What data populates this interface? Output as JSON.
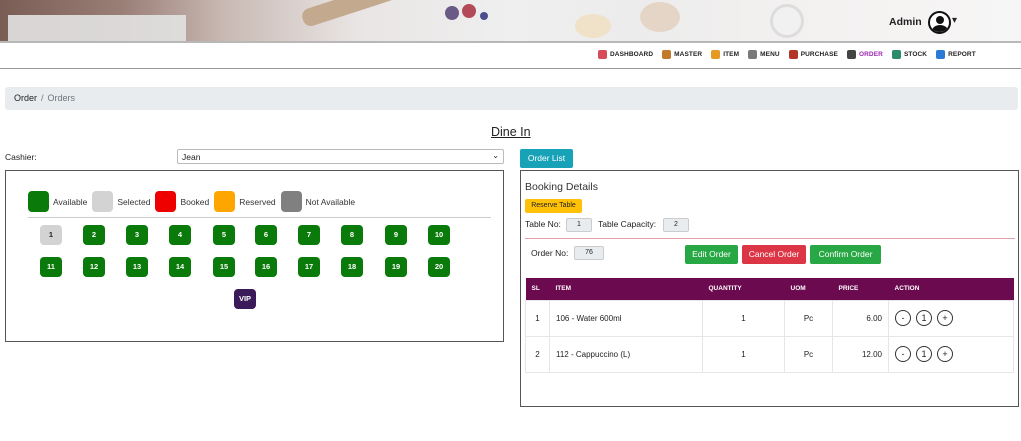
{
  "header": {
    "user_label": "Admin"
  },
  "nav": [
    {
      "label": "DASHBOARD",
      "icon": "dashboard-icon",
      "color": "#d84a5a"
    },
    {
      "label": "MASTER",
      "icon": "master-icon",
      "color": "#c07a2a"
    },
    {
      "label": "ITEM",
      "icon": "item-icon",
      "color": "#e59a22"
    },
    {
      "label": "MENU",
      "icon": "menu-icon",
      "color": "#7a7a7a"
    },
    {
      "label": "PURCHASE",
      "icon": "purchase-icon",
      "color": "#b5342a"
    },
    {
      "label": "ORDER",
      "icon": "order-icon",
      "color": "#444444",
      "active": true
    },
    {
      "label": "STOCK",
      "icon": "stock-icon",
      "color": "#2a8c6a"
    },
    {
      "label": "REPORT",
      "icon": "report-icon",
      "color": "#2a7ad8"
    }
  ],
  "breadcrumb": {
    "root": "Order",
    "separator": "/",
    "current": "Orders"
  },
  "page": {
    "title": "Dine In"
  },
  "cashier": {
    "label": "Cashier:",
    "selected": "Jean"
  },
  "buttons": {
    "order_list": "Order List"
  },
  "legend": [
    {
      "label": "Available",
      "color": "#0a7a0a"
    },
    {
      "label": "Selected",
      "color": "#d3d3d3"
    },
    {
      "label": "Booked",
      "color": "#ee0000"
    },
    {
      "label": "Reserved",
      "color": "#ffa500"
    },
    {
      "label": "Not Available",
      "color": "#808080"
    }
  ],
  "tables": [
    {
      "no": "1",
      "state": "selected"
    },
    {
      "no": "2",
      "state": "available"
    },
    {
      "no": "3",
      "state": "available"
    },
    {
      "no": "4",
      "state": "available"
    },
    {
      "no": "5",
      "state": "available"
    },
    {
      "no": "6",
      "state": "available"
    },
    {
      "no": "7",
      "state": "available"
    },
    {
      "no": "8",
      "state": "available"
    },
    {
      "no": "9",
      "state": "available"
    },
    {
      "no": "10",
      "state": "available"
    },
    {
      "no": "11",
      "state": "available"
    },
    {
      "no": "12",
      "state": "available"
    },
    {
      "no": "13",
      "state": "available"
    },
    {
      "no": "14",
      "state": "available"
    },
    {
      "no": "15",
      "state": "available"
    },
    {
      "no": "16",
      "state": "available"
    },
    {
      "no": "17",
      "state": "available"
    },
    {
      "no": "18",
      "state": "available"
    },
    {
      "no": "19",
      "state": "available"
    },
    {
      "no": "20",
      "state": "available"
    },
    {
      "no": "VIP",
      "state": "vip"
    }
  ],
  "booking": {
    "title": "Booking Details",
    "reserve_label": "Reserve Table",
    "table_no_label": "Table No:",
    "table_no": "1",
    "capacity_label": "Table Capacity:",
    "capacity": "2",
    "order_no_label": "Order No:",
    "order_no": "76",
    "edit_label": "Edit Order",
    "cancel_label": "Cancel Order",
    "confirm_label": "Confirm Order",
    "columns": [
      "SL",
      "ITEM",
      "QUANTITY",
      "UOM",
      "PRICE",
      "ACTION"
    ],
    "rows": [
      {
        "sl": "1",
        "item": "106 - Water 600ml",
        "qty": "1",
        "uom": "Pc",
        "price": "6.00",
        "count": "1"
      },
      {
        "sl": "2",
        "item": "112 - Cappuccino (L)",
        "qty": "1",
        "uom": "Pc",
        "price": "12.00",
        "count": "1"
      }
    ],
    "minus": "-",
    "plus": "+"
  }
}
